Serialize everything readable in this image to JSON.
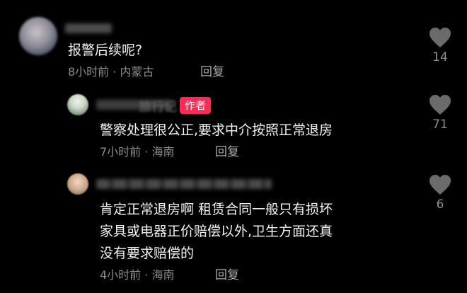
{
  "comments": [
    {
      "text": "报警后续呢?",
      "meta": "8小时前 · 内蒙古",
      "reply_label": "回复",
      "likes": "14"
    },
    {
      "name_tail": "旅行记",
      "badge": "作者",
      "text": "警察处理很公正,要求中介按照正常退房",
      "meta": "7小时前 · 海南",
      "reply_label": "回复",
      "likes": "71"
    },
    {
      "lines": [
        "肯定正常退房啊 租赁合同一般只有损坏",
        "家具或电器正价赔偿以外,卫生方面还真",
        "没有要求赔偿的"
      ],
      "meta": "4小时前 · 海南",
      "reply_label": "回复",
      "likes": "6"
    }
  ],
  "colors": {
    "background": "#000000",
    "badge": "#fe2c55",
    "heart": "#6b6b6b"
  },
  "icons": {
    "like": "heart-icon"
  }
}
